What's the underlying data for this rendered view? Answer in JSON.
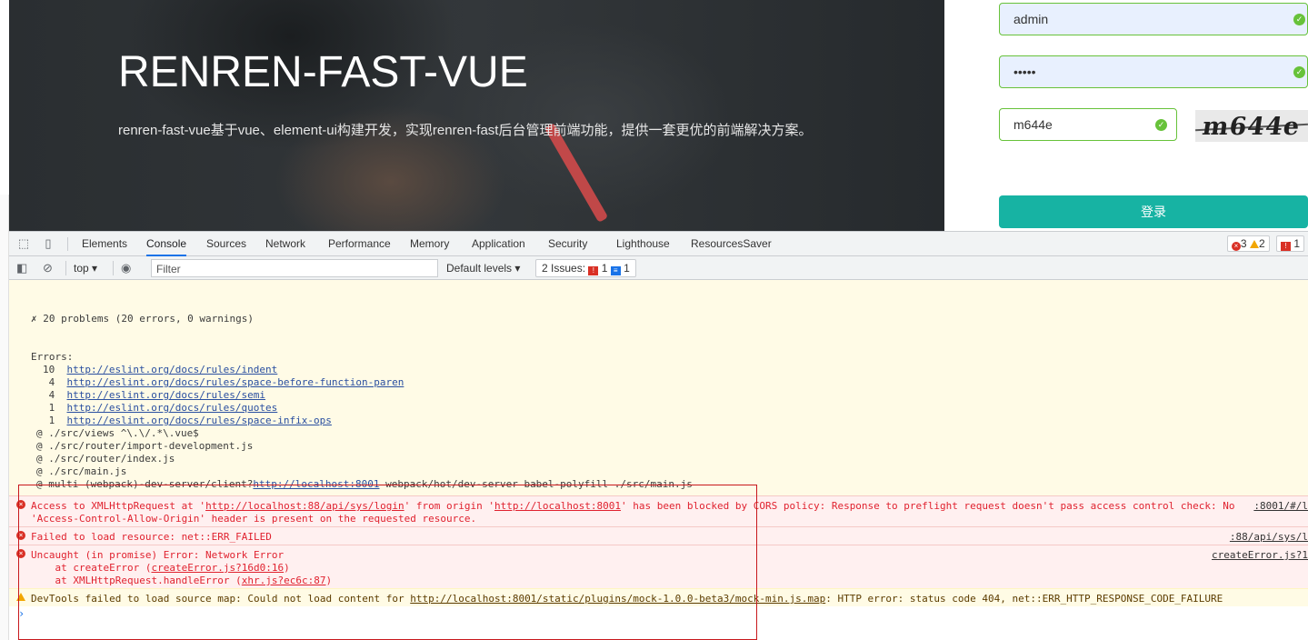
{
  "hero": {
    "title": "RENREN-FAST-VUE",
    "description": "renren-fast-vue基于vue、element-ui构建开发，实现renren-fast后台管理前端功能，提供一套更优的前端解决方案。"
  },
  "login": {
    "username": "admin",
    "password": "•••••",
    "captcha_value": "m644e",
    "captcha_image_text": "m644e",
    "submit_label": "登录"
  },
  "devtools": {
    "tabs": [
      "Elements",
      "Console",
      "Sources",
      "Network",
      "Performance",
      "Memory",
      "Application",
      "Security",
      "Lighthouse",
      "ResourcesSaver"
    ],
    "active_tab": "Console",
    "badges": {
      "errors": "3",
      "warnings": "2",
      "issues": "1"
    },
    "toolbar": {
      "context": "top",
      "filter_placeholder": "Filter",
      "levels": "Default levels",
      "issues_label": "2 Issues:",
      "issues_errors": "1",
      "issues_info": "1"
    }
  },
  "overlay": {
    "summary": "✗ 20 problems (20 errors, 0 warnings)",
    "errors_heading": "Errors:",
    "rules": [
      {
        "count": "10",
        "url": "http://eslint.org/docs/rules/indent"
      },
      {
        "count": "4",
        "url": "http://eslint.org/docs/rules/space-before-function-paren"
      },
      {
        "count": "4",
        "url": "http://eslint.org/docs/rules/semi"
      },
      {
        "count": "1",
        "url": "http://eslint.org/docs/rules/quotes"
      },
      {
        "count": "1",
        "url": "http://eslint.org/docs/rules/space-infix-ops"
      }
    ],
    "trace": [
      "@ ./src/views ^\\.\\/.*\\.vue$",
      "@ ./src/router/import-development.js",
      "@ ./src/router/index.js",
      "@ ./src/main.js"
    ],
    "trace_last_prefix": "@ multi (webpack)-dev-server/client?",
    "trace_last_link": "http://localhost:8001",
    "trace_last_suffix": " webpack/hot/dev-server babel-polyfill ./src/main.js"
  },
  "console_messages": {
    "cors_line1_a": "Access to XMLHttpRequest at '",
    "cors_url1": "http://localhost:88/api/sys/login",
    "cors_line1_b": "' from origin '",
    "cors_url2": "http://localhost:8001",
    "cors_line1_c": "' has been blocked by CORS policy: Response to preflight request doesn't pass access control check: No",
    "cors_line2": "'Access-Control-Allow-Origin' header is present on the requested resource.",
    "cors_src": ":8001/#/l",
    "failed_text": "Failed to load resource: net::ERR_FAILED",
    "failed_src": ":88/api/sys/l",
    "uncaught_line1": "Uncaught (in promise) Error: Network Error",
    "uncaught_line2_a": "    at createError (",
    "uncaught_line2_link": "createError.js?16d0:16",
    "uncaught_line2_b": ")",
    "uncaught_line3_a": "    at XMLHttpRequest.handleError (",
    "uncaught_line3_link": "xhr.js?ec6c:87",
    "uncaught_line3_b": ")",
    "uncaught_src": "createError.js?1",
    "warn_a": "DevTools failed to load source map: Could not load content for ",
    "warn_link": "http://localhost:8001/static/plugins/mock-1.0.0-beta3/mock-min.js.map",
    "warn_b": ": HTTP error: status code 404, net::ERR_HTTP_RESPONSE_CODE_FAILURE",
    "prompt": "›"
  }
}
